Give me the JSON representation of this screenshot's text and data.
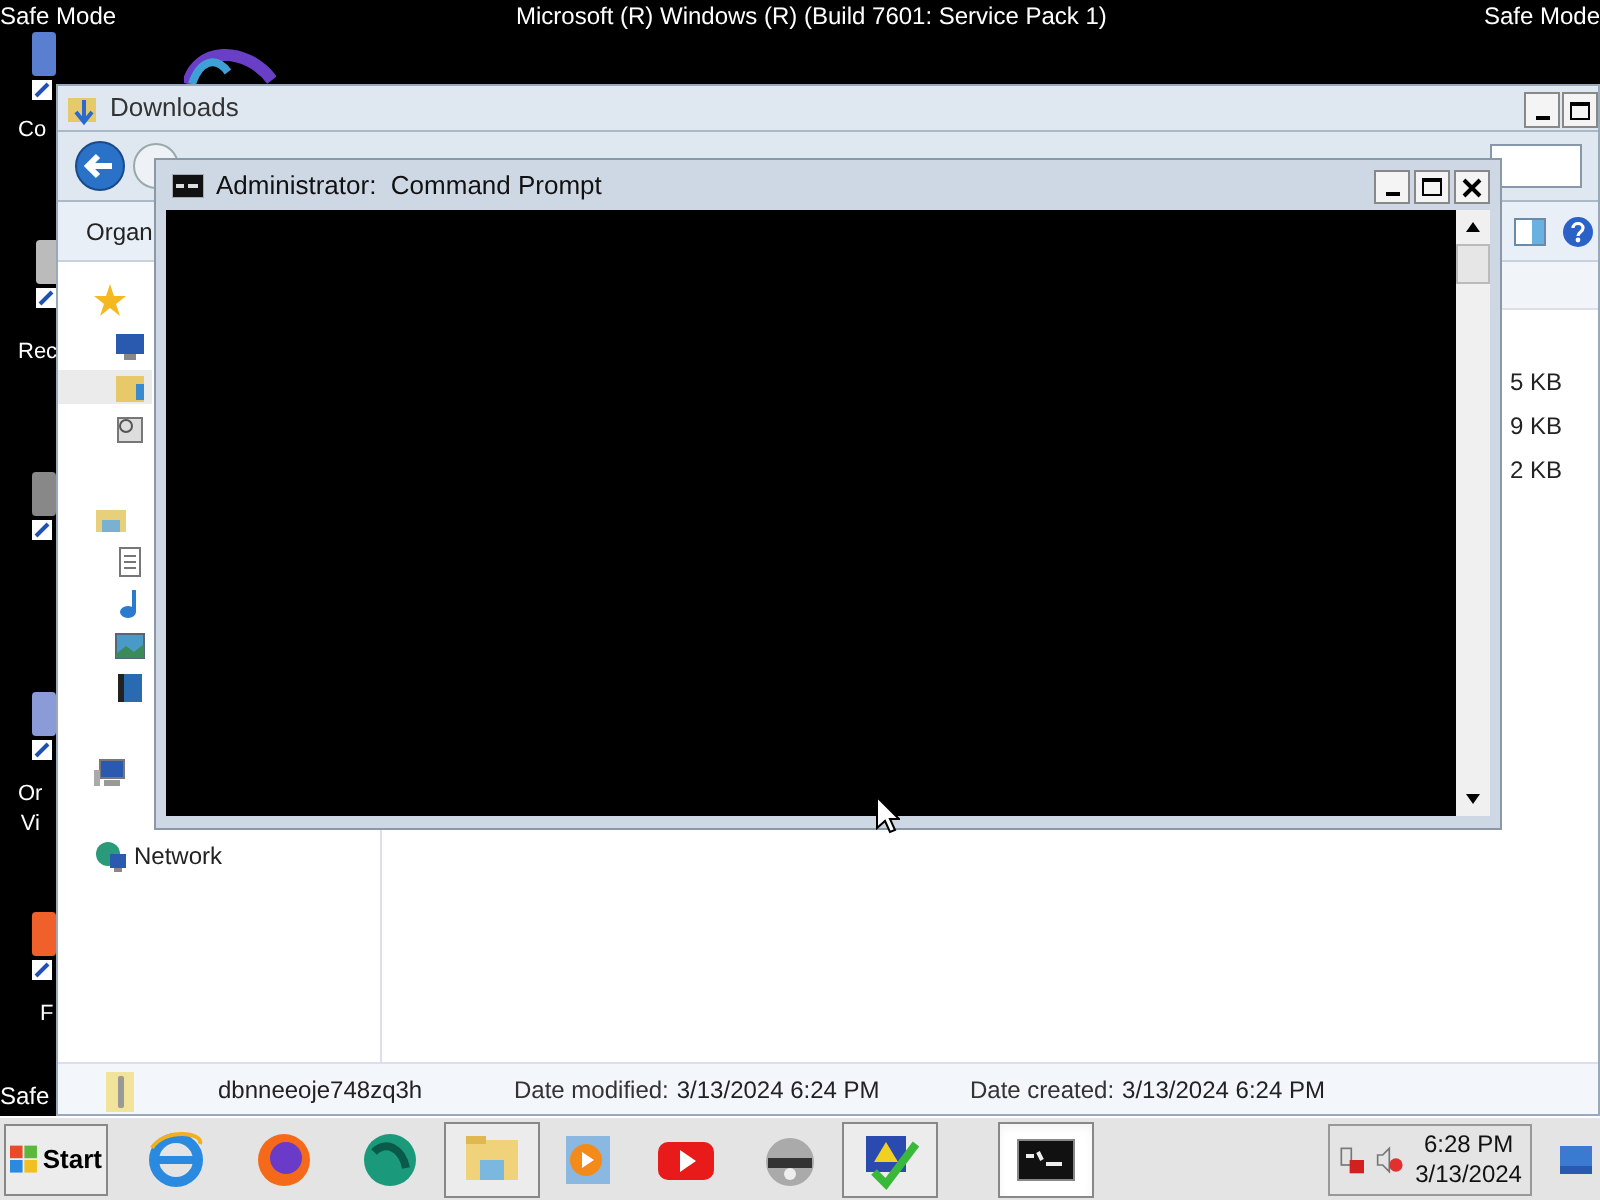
{
  "desktop": {
    "top_left": "Safe Mode",
    "top_center": "Microsoft (R) Windows (R) (Build 7601: Service Pack 1)",
    "top_right": "Safe Mode",
    "bottom_left": "Safe",
    "icon_labels": [
      {
        "lines": [
          "Co"
        ]
      },
      {
        "lines": [
          "Rec"
        ]
      },
      {
        "lines": [
          "Or",
          "Vi"
        ]
      },
      {
        "lines": [
          "F"
        ]
      }
    ]
  },
  "explorer": {
    "title": "Downloads",
    "organize": "Organ",
    "network": "Network",
    "nav_icons": [
      {
        "kind": "star",
        "selected": false
      },
      {
        "kind": "desktop",
        "selected": false
      },
      {
        "kind": "folder",
        "selected": true
      },
      {
        "kind": "recent",
        "selected": false
      },
      {
        "kind": "library",
        "selected": false
      },
      {
        "kind": "document",
        "selected": false
      },
      {
        "kind": "music",
        "selected": false
      },
      {
        "kind": "pictures",
        "selected": false
      },
      {
        "kind": "video",
        "selected": false
      },
      {
        "kind": "computer",
        "selected": false
      }
    ],
    "sizes": [
      "5 KB",
      "9 KB",
      "2 KB"
    ],
    "details": {
      "name": "dbnneeoje748zq3h",
      "fields": [
        {
          "label": "Date modified:",
          "value": "3/13/2024 6:24 PM"
        },
        {
          "label": "Date created:",
          "value": "3/13/2024 6:24 PM"
        }
      ]
    }
  },
  "cmd": {
    "title": "Administrator:  Command Prompt"
  },
  "taskbar": {
    "start": "Start",
    "apps": [
      {
        "kind": "ie",
        "open": false,
        "selected": false
      },
      {
        "kind": "firefox",
        "open": false,
        "selected": false
      },
      {
        "kind": "globe",
        "open": false,
        "selected": false
      },
      {
        "kind": "explorer",
        "open": true,
        "selected": false
      },
      {
        "kind": "player",
        "open": false,
        "selected": false
      },
      {
        "kind": "youtube",
        "open": false,
        "selected": false
      },
      {
        "kind": "raccoon",
        "open": false,
        "selected": false
      },
      {
        "kind": "security",
        "open": true,
        "selected": false
      },
      {
        "kind": "cmd",
        "open": true,
        "selected": true
      }
    ],
    "clock": {
      "time": "6:28 PM",
      "date": "3/13/2024"
    }
  }
}
